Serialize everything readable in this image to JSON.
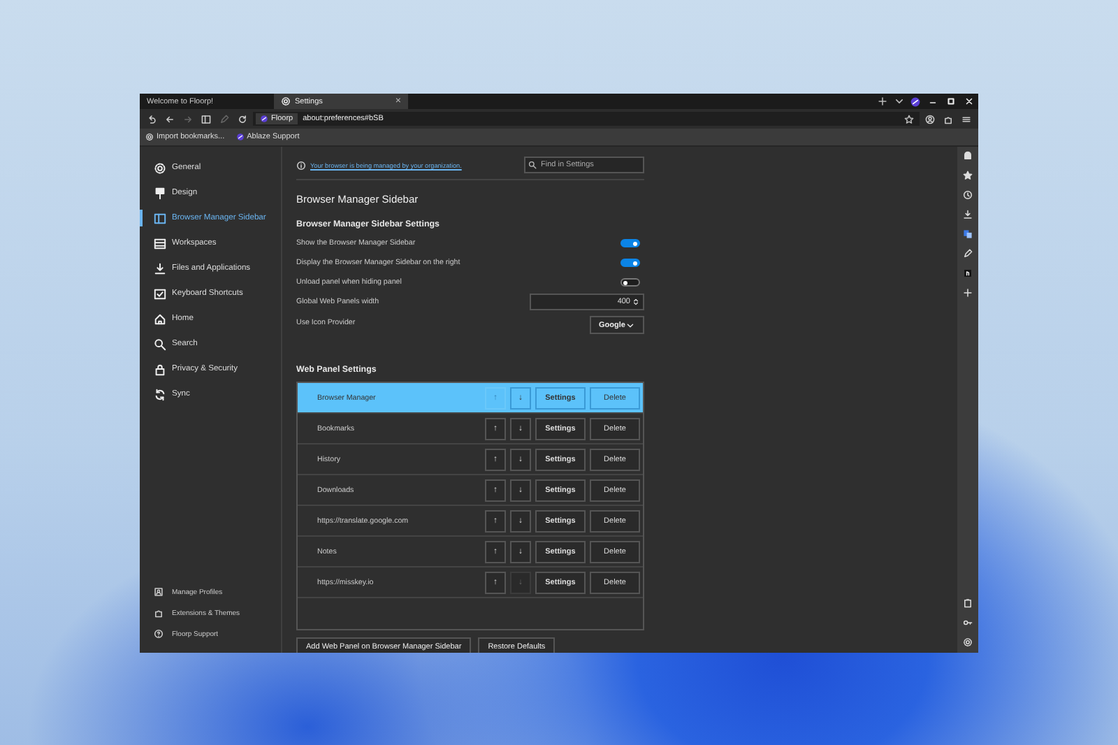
{
  "browser": {
    "tabs": [
      {
        "title": "Welcome to Floorp!",
        "selected": false
      },
      {
        "title": "Settings",
        "selected": true,
        "close": "×"
      }
    ],
    "identity": "Floorp",
    "url": "about:preferences#bSB",
    "bookmarks": [
      "Import bookmarks...",
      "Ablaze Support"
    ]
  },
  "settings_nav": {
    "items": [
      {
        "label": "General",
        "selected": false
      },
      {
        "label": "Design",
        "selected": false
      },
      {
        "label": "Browser Manager Sidebar",
        "selected": true
      },
      {
        "label": "Workspaces",
        "selected": false
      },
      {
        "label": "Files and Applications",
        "selected": false
      },
      {
        "label": "Keyboard Shortcuts",
        "selected": false
      },
      {
        "label": "Home",
        "selected": false
      },
      {
        "label": "Search",
        "selected": false
      },
      {
        "label": "Privacy & Security",
        "selected": false
      },
      {
        "label": "Sync",
        "selected": false
      }
    ],
    "footer": [
      "Manage Profiles",
      "Extensions & Themes",
      "Floorp Support"
    ]
  },
  "notice": "Your browser is being managed by your organization.",
  "search": {
    "placeholder": "Find in Settings"
  },
  "title": "Browser Manager Sidebar",
  "section": {
    "heading": "Browser Manager Sidebar Settings",
    "settings": [
      {
        "kind": "toggle",
        "label": "Show the Browser Manager Sidebar",
        "on": true
      },
      {
        "kind": "toggle",
        "label": "Display the Browser Manager Sidebar on the right",
        "on": true
      },
      {
        "kind": "toggle",
        "label": "Unload panel when hiding panel",
        "on": false
      },
      {
        "kind": "number",
        "label": "Global Web Panels width",
        "value": "400"
      },
      {
        "kind": "select",
        "label": "Use Icon Provider",
        "value": "Google"
      }
    ]
  },
  "web_panels": {
    "heading": "Web Panel Settings",
    "rows": [
      {
        "name": "Browser Manager",
        "selected": true,
        "up": "↑",
        "up_disabled": true,
        "down": "↓",
        "down_disabled": false,
        "settings": "Settings",
        "delete": "Delete"
      },
      {
        "name": "Bookmarks",
        "selected": false,
        "up": "↑",
        "up_disabled": false,
        "down": "↓",
        "down_disabled": false,
        "settings": "Settings",
        "delete": "Delete"
      },
      {
        "name": "History",
        "selected": false,
        "up": "↑",
        "up_disabled": false,
        "down": "↓",
        "down_disabled": false,
        "settings": "Settings",
        "delete": "Delete"
      },
      {
        "name": "Downloads",
        "selected": false,
        "up": "↑",
        "up_disabled": false,
        "down": "↓",
        "down_disabled": false,
        "settings": "Settings",
        "delete": "Delete"
      },
      {
        "name": "https://translate.google.com",
        "selected": false,
        "up": "↑",
        "up_disabled": false,
        "down": "↓",
        "down_disabled": false,
        "settings": "Settings",
        "delete": "Delete"
      },
      {
        "name": "Notes",
        "selected": false,
        "up": "↑",
        "up_disabled": false,
        "down": "↓",
        "down_disabled": false,
        "settings": "Settings",
        "delete": "Delete"
      },
      {
        "name": "https://misskey.io",
        "selected": false,
        "up": "↑",
        "up_disabled": false,
        "down": "↓",
        "down_disabled": true,
        "settings": "Settings",
        "delete": "Delete"
      }
    ]
  },
  "actions": [
    "Add Web Panel on Browser Manager Sidebar",
    "Restore Defaults"
  ]
}
